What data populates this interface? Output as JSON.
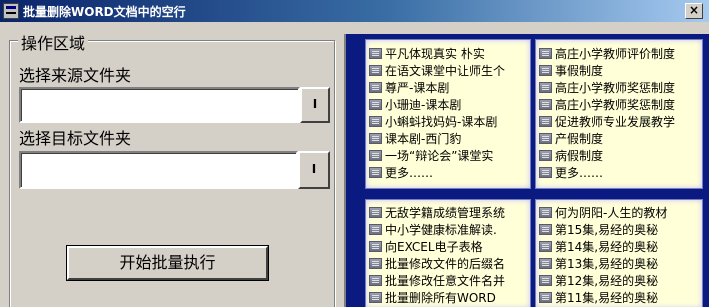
{
  "window": {
    "title": "批量删除WORD文档中的空行",
    "close_label": "×"
  },
  "left": {
    "group_title": "操作区域",
    "source_label": "选择来源文件夹",
    "source_value": "",
    "source_browse_label": "I",
    "target_label": "选择目标文件夹",
    "target_value": "",
    "target_browse_label": "I",
    "start_label": "开始批量执行"
  },
  "panels": [
    {
      "items": [
        "平凡体现真实 朴实",
        "在语文课堂中让师生个",
        "尊严-课本剧",
        "小珊迪-课本剧",
        "小蝌蚪找妈妈-课本剧",
        "课本剧-西门豹",
        "一场“辩论会”课堂实",
        "更多……"
      ]
    },
    {
      "items": [
        "高庄小学教师评价制度",
        "事假制度",
        "高庄小学教师奖惩制度",
        "高庄小学教师奖惩制度",
        "促进教师专业发展教学",
        "产假制度",
        "病假制度",
        "更多……"
      ]
    },
    {
      "items": [
        "无敌学籍成绩管理系统",
        "中小学健康标准解读.",
        "向EXCEL电子表格",
        "批量修改文件的后缀名",
        "批量修改任意文件名并",
        "批量删除所有WORD"
      ]
    },
    {
      "items": [
        "何为阴阳-人生的教材",
        "第15集,易经的奥秘",
        "第14集,易经的奥秘",
        "第13集,易经的奥秘",
        "第12集,易经的奥秘",
        "第11集,易经的奥秘"
      ]
    }
  ]
}
